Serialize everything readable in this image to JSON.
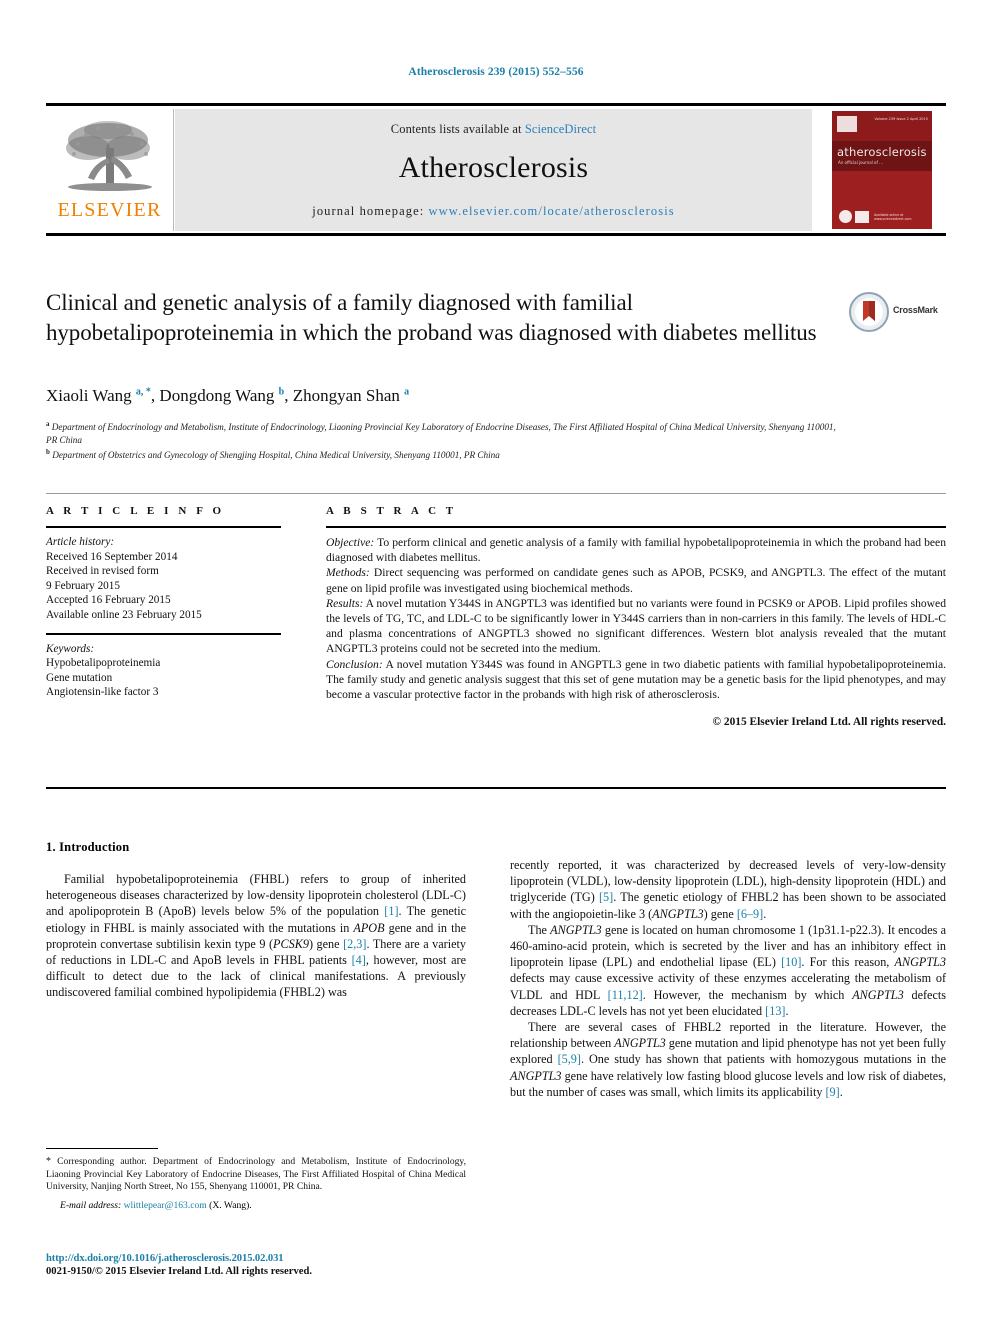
{
  "citation": "Atherosclerosis 239 (2015) 552–556",
  "masthead": {
    "contents_prefix": "Contents lists available at ",
    "sciencedirect": "ScienceDirect",
    "journal_name": "Atherosclerosis",
    "homepage_prefix": "journal homepage: ",
    "homepage_url": "www.elsevier.com/locate/atherosclerosis",
    "publisher_logo_text": "ELSEVIER",
    "cover_title": "atherosclerosis",
    "cover_subtitle": "An official journal of ...",
    "cover_top_text": "Volume 239  Issue 2  April 2015",
    "cover_bottom_text": "Available online at\nwww.sciencedirect.com"
  },
  "crossmark": {
    "label": "CrossMark"
  },
  "article": {
    "title": "Clinical and genetic analysis of a family diagnosed with familial hypobetalipoproteinemia in which the proband was diagnosed with diabetes mellitus",
    "authors_html": "Xiaoli Wang <sup>a, *</sup>, Dongdong Wang <sup>b</sup>, Zhongyan Shan <sup>a</sup>",
    "affiliation_a": "Department of Endocrinology and Metabolism, Institute of Endocrinology, Liaoning Provincial Key Laboratory of Endocrine Diseases, The First Affiliated Hospital of China Medical University, Shenyang 110001, PR China",
    "affiliation_b": "Department of Obstetrics and Gynecology of Shengjing Hospital, China Medical University, Shenyang 110001, PR China"
  },
  "article_info": {
    "heading": "A R T I C L E   I N F O",
    "history_label": "Article history:",
    "history": [
      "Received 16 September 2014",
      "Received in revised form",
      "9 February 2015",
      "Accepted 16 February 2015",
      "Available online 23 February 2015"
    ],
    "keywords_label": "Keywords:",
    "keywords": [
      "Hypobetalipoproteinemia",
      "Gene mutation",
      "Angiotensin-like factor 3"
    ]
  },
  "abstract": {
    "heading": "A B S T R A C T",
    "objective_label": "Objective:",
    "objective_text": " To perform clinical and genetic analysis of a family with familial hypobetalipoproteinemia in which the proband had been diagnosed with diabetes mellitus.",
    "methods_label": "Methods:",
    "methods_text": " Direct sequencing was performed on candidate genes such as APOB, PCSK9, and ANGPTL3. The effect of the mutant gene on lipid profile was investigated using biochemical methods.",
    "results_label": "Results:",
    "results_text": " A novel mutation Y344S in ANGPTL3 was identified but no variants were found in PCSK9 or APOB. Lipid profiles showed the levels of TG, TC, and LDL-C to be significantly lower in Y344S carriers than in non-carriers in this family. The levels of HDL-C and plasma concentrations of ANGPTL3 showed no significant differences. Western blot analysis revealed that the mutant ANGPTL3 proteins could not be secreted into the medium.",
    "conclusion_label": "Conclusion:",
    "conclusion_text": " A novel mutation Y344S was found in ANGPTL3 gene in two diabetic patients with familial hypobetalipoproteinemia. The family study and genetic analysis suggest that this set of gene mutation may be a genetic basis for the lipid phenotypes, and may become a vascular protective factor in the probands with high risk of atherosclerosis.",
    "copyright": "© 2015 Elsevier Ireland Ltd. All rights reserved."
  },
  "introduction": {
    "heading": "1. Introduction",
    "para1_html": "Familial hypobetalipoproteinemia (FHBL) refers to group of inherited heterogeneous diseases characterized by low-density lipoprotein cholesterol (LDL-C) and apolipoprotein B (ApoB) levels below 5% of the population <span class=\"ref\">[1]</span>. The genetic etiology in FHBL is mainly associated with the mutations in <i>APOB</i> gene and in the proprotein convertase subtilisin kexin type 9 (<i>PCSK9</i>) gene <span class=\"ref\">[2,3]</span>. There are a variety of reductions in LDL-C and ApoB levels in FHBL patients <span class=\"ref\">[4]</span>, however, most are difficult to detect due to the lack of clinical manifestations. A previously undiscovered familial combined hypolipidemia (FHBL2) was recently reported, it was characterized by decreased levels of very-low-density lipoprotein (VLDL), low-density lipoprotein (LDL), high-density lipoprotein (HDL) and triglyceride (TG) <span class=\"ref\">[5]</span>. The genetic etiology of FHBL2 has been shown to be associated with the angiopoietin-like 3 (<i>ANGPTL3</i>) gene <span class=\"ref\">[6–9]</span>.",
    "para2_html": "The <i>ANGPTL3</i> gene is located on human chromosome 1 (1p31.1-p22.3). It encodes a 460-amino-acid protein, which is secreted by the liver and has an inhibitory effect in lipoprotein lipase (LPL) and endothelial lipase (EL) <span class=\"ref\">[10]</span>. For this reason, <i>ANGPTL3</i> defects may cause excessive activity of these enzymes accelerating the metabolism of VLDL and HDL <span class=\"ref\">[11,12]</span>. However, the mechanism by which <i>ANGPTL3</i> defects decreases LDL-C levels has not yet been elucidated <span class=\"ref\">[13]</span>.",
    "para3_html": "There are several cases of FHBL2 reported in the literature. However, the relationship between <i>ANGPTL3</i> gene mutation and lipid phenotype has not yet been fully explored <span class=\"ref\">[5,9]</span>. One study has shown that patients with homozygous mutations in the <i>ANGPTL3</i> gene have relatively low fasting blood glucose levels and low risk of diabetes, but the number of cases was small, which limits its applicability <span class=\"ref\">[9]</span>."
  },
  "footnote": {
    "corresponding_html": "<span class=\"star\">*</span> Corresponding author. Department of Endocrinology and Metabolism, Institute of Endocrinology, Liaoning Provincial Key Laboratory of Endocrine Diseases, The First Affiliated Hospital of China Medical University, Nanjing North Street, No 155, Shenyang 110001, PR China.",
    "email_label": "E-mail address:",
    "email": "wlittlepear@163.com",
    "email_suffix": " (X. Wang)."
  },
  "doi": {
    "url": "http://dx.doi.org/10.1016/j.atherosclerosis.2015.02.031",
    "issn_line": "0021-9150/© 2015 Elsevier Ireland Ltd. All rights reserved."
  },
  "colors": {
    "link": "#1b7fa8",
    "elsevier_orange": "#F08000",
    "cover_red": "#9d1f1f"
  }
}
